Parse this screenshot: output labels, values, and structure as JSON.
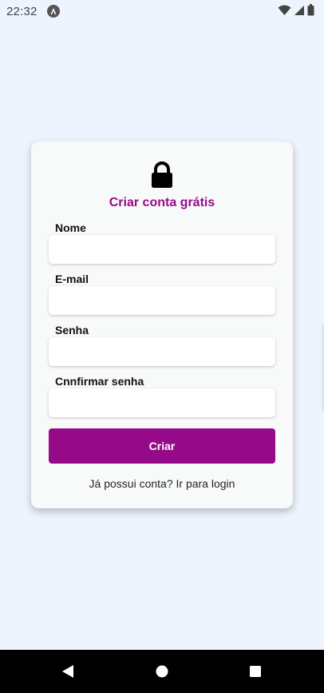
{
  "status_bar": {
    "time": "22:32",
    "app_icon": "a-icon",
    "icons": [
      "wifi-icon",
      "signal-icon",
      "battery-icon"
    ]
  },
  "form": {
    "icon": "lock-icon",
    "title": "Criar conta grátis",
    "fields": [
      {
        "label": "Nome",
        "value": "",
        "placeholder": ""
      },
      {
        "label": "E-mail",
        "value": "",
        "placeholder": ""
      },
      {
        "label": "Senha",
        "value": "",
        "placeholder": ""
      },
      {
        "label": "Cnnfirmar senha",
        "value": "",
        "placeholder": ""
      }
    ],
    "submit_label": "Criar",
    "login_link": "Já possui conta? Ir para login"
  },
  "nav_bar": {
    "buttons": [
      "back-icon",
      "home-icon",
      "recents-icon"
    ]
  },
  "colors": {
    "accent": "#960a8a",
    "background": "#eef4fd",
    "card": "#f8fafa"
  }
}
